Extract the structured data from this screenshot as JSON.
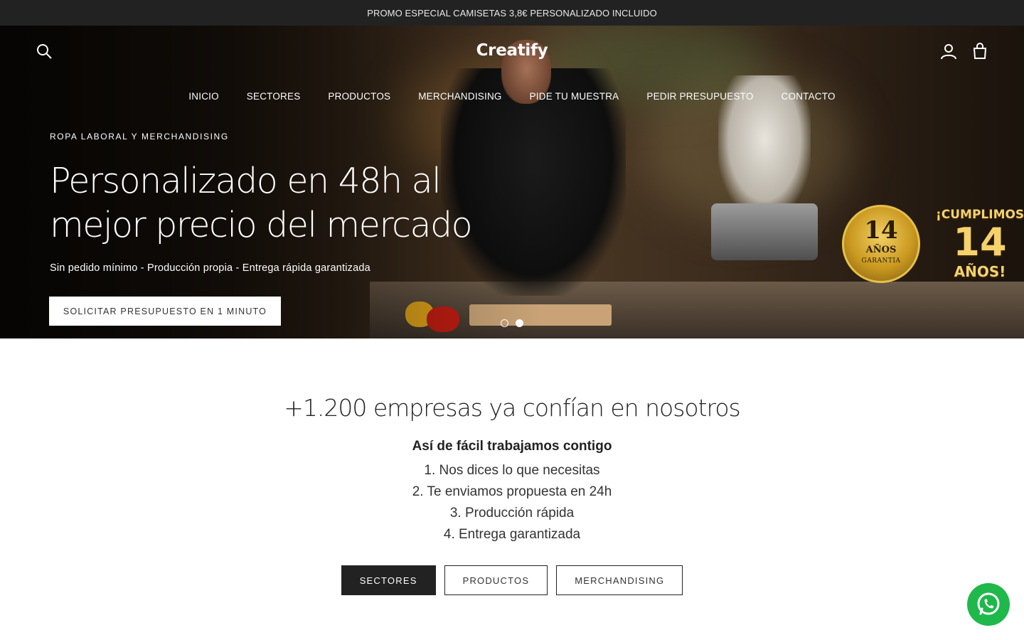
{
  "promo": {
    "text": "PROMO ESPECIAL CAMISETAS 3,8€ PERSONALIZADO INCLUIDO"
  },
  "header": {
    "logo": "Creatify",
    "icons": {
      "search": "search-icon",
      "account": "account-icon",
      "cart": "cart-icon"
    }
  },
  "nav": {
    "items": [
      "INICIO",
      "SECTORES",
      "PRODUCTOS",
      "MERCHANDISING",
      "PIDE TU MUESTRA",
      "PEDIR PRESUPUESTO",
      "CONTACTO"
    ]
  },
  "hero": {
    "eyebrow": "ROPA LABORAL Y MERCHANDISING",
    "title": "Personalizado en 48h al mejor precio del mercado",
    "subtitle": "Sin pedido mínimo - Producción propia - Entrega rápida garantizada",
    "cta": "SOLICITAR PRESUPUESTO EN 1 MINUTO",
    "slides": {
      "count": 2,
      "active": 2
    },
    "badge": {
      "number": "14",
      "years": "AÑOS",
      "guarantee": "GARANTIA"
    },
    "celebration": {
      "line1": "¡CUMPLIMOS",
      "line2": "14",
      "line3": "AÑOS!"
    }
  },
  "trust": {
    "title": "+1.200 empresas ya confían en nosotros",
    "steps_heading": "Así de fácil trabajamos contigo",
    "steps": [
      "1. Nos dices lo que necesitas",
      "2. Te enviamos propuesta en 24h",
      "3. Producción rápida",
      "4. Entrega garantizada"
    ]
  },
  "categories": {
    "sectores": "SECTORES",
    "productos": "PRODUCTOS",
    "merchandising": "MERCHANDISING"
  },
  "whatsapp": {
    "icon": "whatsapp-icon"
  },
  "colors": {
    "dark": "#222222",
    "white": "#ffffff",
    "whatsapp": "#1fb84b",
    "gold": "#c9981f"
  }
}
